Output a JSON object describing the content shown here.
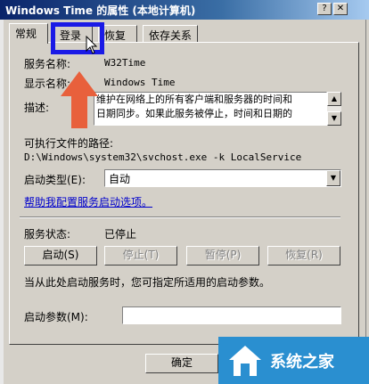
{
  "window": {
    "title": "Windows Time 的属性 (本地计算机)"
  },
  "tabs": [
    {
      "label": "常规",
      "active": true
    },
    {
      "label": "登录",
      "active": false
    },
    {
      "label": "恢复",
      "active": false
    },
    {
      "label": "依存关系",
      "active": false
    }
  ],
  "general": {
    "service_name_label": "服务名称:",
    "service_name_value": "W32Time",
    "display_name_label": "显示名称:",
    "display_name_value": "Windows Time",
    "description_label": "描述:",
    "description_line1": "维护在网络上的所有客户端和服务器的时间和",
    "description_line2": "日期同步。如果此服务被停止，时间和日期的",
    "exe_path_label": "可执行文件的路径:",
    "exe_path_value": "D:\\Windows\\system32\\svchost.exe -k LocalService",
    "startup_type_label": "启动类型(E):",
    "startup_type_value": "自动",
    "help_link": "帮助我配置服务启动选项。",
    "status_label": "服务状态:",
    "status_value": "已停止",
    "buttons": {
      "start": "启动(S)",
      "stop": "停止(T)",
      "pause": "暂停(P)",
      "resume": "恢复(R)"
    },
    "hint": "当从此处启动服务时，您可指定所适用的启动参数。",
    "start_params_label": "启动参数(M):",
    "start_params_value": ""
  },
  "footer": {
    "ok": "确定"
  },
  "watermark": {
    "text": "系统之家"
  },
  "colors": {
    "highlight": "#1a1ae6",
    "arrow": "#e8603c",
    "watermark_bg": "#2a8fd0"
  }
}
